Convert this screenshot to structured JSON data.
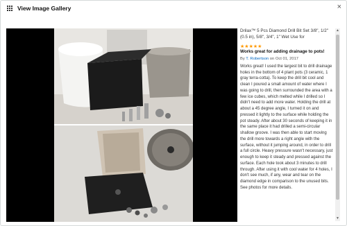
{
  "dialog": {
    "title": "View Image Gallery",
    "close_glyph": "×",
    "icon": "grid-icon"
  },
  "review": {
    "product_title": "Drilax™ 5 Pcs Diamond Drill Bit Set 3/8\", 1/2\" (0.5 in), 5/8\", 3/4\", 1\" Wet Use for",
    "rating": 5,
    "star_glyph": "★",
    "title": "Works great for adding drainage to pots!",
    "by_prefix": "By",
    "author": "T. Robertson",
    "date_text": "on Oct 01, 2017",
    "body": "Works great! I used the largest bit to drill drainage holes in the bottom of 4 plant pots (3 ceramic, 1 gray terra-cotta). To keep the drill bit cool and clean I poured a small amount of water where I was going to drill, then surrounded the area with a few ice cubes, which melted while I drilled so I didn't need to add more water. Holding the drill at about a 45 degree angle, I turned it on and pressed it lightly to the surface while holding the pot steady. After about 30 seconds of keeping it in the same place it had drilled a semi-circular shallow groove. I was then able to start moving the drill more towards a right angle with the surface, without it jumping around, in order to drill a full circle. Heavy pressure wasn't necessary, just enough to keep it steady and pressed against the surface. Each hole took about 3 minutes to drill through. After using it with cool water for 4 holes, I don't see much, if any, wear and tear on the diamond edge in comparison to the unused bits. See photos for more details."
  },
  "scrollbar": {
    "up_glyph": "▲",
    "down_glyph": "▼"
  },
  "colors": {
    "star": "#ff9900",
    "link": "#0066c0",
    "viewer_background": "#000000"
  }
}
